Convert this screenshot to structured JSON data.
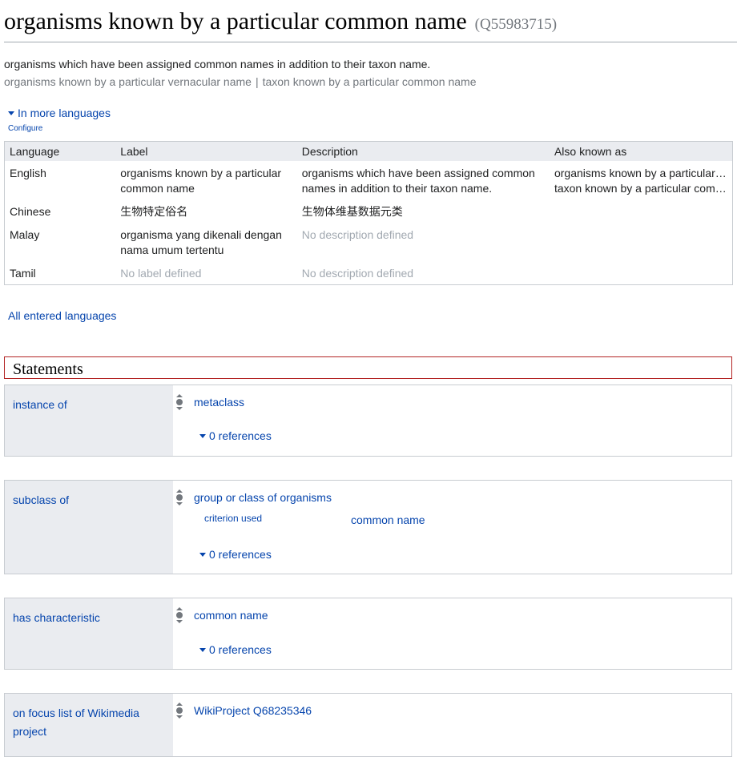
{
  "header": {
    "title": "organisms known by a particular common name",
    "qid": "(Q55983715)",
    "description": "organisms which have been assigned common names in addition to their taxon name.",
    "aliases": [
      "organisms known by a particular vernacular name",
      "taxon known by a particular common name"
    ],
    "alias_separator": "|"
  },
  "languages": {
    "toggle_label": "In more languages",
    "configure_label": "Configure",
    "columns": [
      "Language",
      "Label",
      "Description",
      "Also known as"
    ],
    "rows": [
      {
        "language": "English",
        "label": "organisms known by a particular common name",
        "description": "organisms which have been assigned common names in addition to their taxon name.",
        "aliases": [
          "organisms known by a particular vernacular name",
          "taxon known by a particular common name"
        ]
      },
      {
        "language": "Chinese",
        "label": "生物特定俗名",
        "description": "生物体维基数据元类",
        "aliases": []
      },
      {
        "language": "Malay",
        "label": "organisma yang dikenali dengan nama umum tertentu",
        "description": "No description defined",
        "aliases": []
      },
      {
        "language": "Tamil",
        "label": "No label defined",
        "description": "No description defined",
        "aliases": []
      }
    ],
    "all_languages_label": "All entered languages"
  },
  "statements": {
    "heading": "Statements",
    "groups": [
      {
        "property": "instance of",
        "value": "metaclass",
        "references": "0 references"
      },
      {
        "property": "subclass of",
        "value": "group or class of organisms",
        "qualifier_property": "criterion used",
        "qualifier_value": "common name",
        "references": "0 references"
      },
      {
        "property": "has characteristic",
        "value": "common name",
        "references": "0 references"
      },
      {
        "property": "on focus list of Wikimedia project",
        "value": "WikiProject Q68235346"
      }
    ]
  },
  "colors": {
    "link": "#0645ad",
    "muted": "#72777d",
    "placeholder": "#a2a9b1",
    "header_bg": "#eaecf0",
    "statements_border": "#b32424"
  }
}
